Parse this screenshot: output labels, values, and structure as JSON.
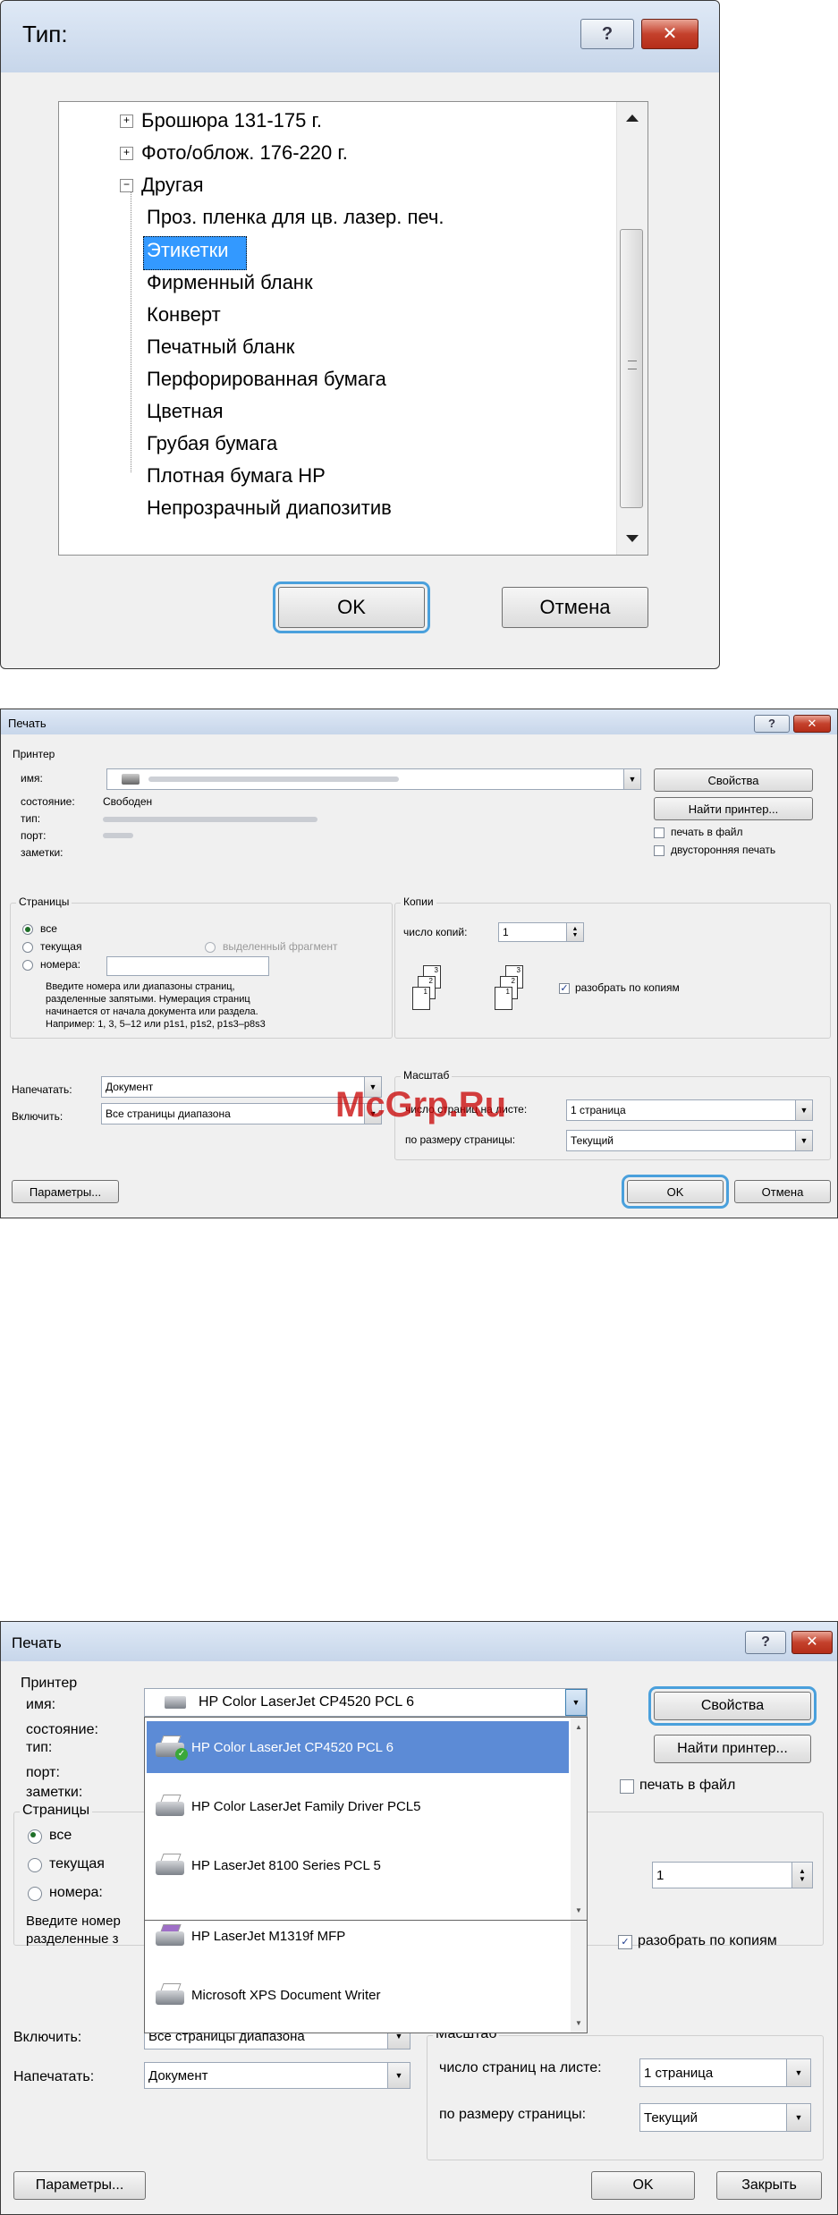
{
  "dialog1": {
    "title": "Тип:",
    "help_label": "?",
    "close_label": "✕",
    "tree": [
      {
        "label": "Брошюра 131-175 г.",
        "expander": "+",
        "level": 1
      },
      {
        "label": "Фото/облож. 176-220 г.",
        "expander": "+",
        "level": 1
      },
      {
        "label": "Другая",
        "expander": "−",
        "level": 1
      },
      {
        "label": "Проз. пленка для цв. лазер. печ.",
        "level": 2
      },
      {
        "label": "Этикетки",
        "level": 2,
        "selected": true
      },
      {
        "label": "Фирменный бланк",
        "level": 2
      },
      {
        "label": "Конверт",
        "level": 2
      },
      {
        "label": "Печатный бланк",
        "level": 2
      },
      {
        "label": "Перфорированная бумага",
        "level": 2
      },
      {
        "label": "Цветная",
        "level": 2
      },
      {
        "label": "Грубая бумага",
        "level": 2
      },
      {
        "label": "Плотная бумага HP",
        "level": 2
      },
      {
        "label": "Непрозрачный диапозитив",
        "level": 2
      }
    ],
    "ok_label": "OK",
    "cancel_label": "Отмена"
  },
  "dialog2": {
    "title": "Печать",
    "help_label": "?",
    "close_label": "✕",
    "printer_group": "Принтер",
    "name_label": "имя:",
    "status_label": "состояние:",
    "status_value": "Свободен",
    "type_label": "тип:",
    "port_label": "порт:",
    "notes_label": "заметки:",
    "properties_label": "Свойства",
    "find_printer_label": "Найти принтер...",
    "print_to_file_label": "печать в файл",
    "duplex_label": "двусторонняя печать",
    "pages_group": "Страницы",
    "all_label": "все",
    "current_label": "текущая",
    "selection_label": "выделенный фрагмент",
    "pages_label": "номера:",
    "pages_hint": [
      "Введите номера или диапазоны страниц,",
      "разделенные запятыми. Нумерация страниц",
      "начинается от начала документа или раздела.",
      "Например: 1, 3, 5–12 или p1s1, p1s2, p1s3–p8s3"
    ],
    "copies_group": "Копии",
    "copies_label": "число копий:",
    "copies_value": "1",
    "collate_label": "разобрать по копиям",
    "print_what_label": "Напечатать:",
    "print_what_value": "Документ",
    "include_label": "Включить:",
    "include_value": "Все страницы диапазона",
    "zoom_group": "Масштаб",
    "pages_per_sheet_label": "число страниц на листе:",
    "pages_per_sheet_value": "1 страница",
    "scale_label": "по размеру страницы:",
    "scale_value": "Текущий",
    "watermark": "McGrp.Ru",
    "options_label": "Параметры...",
    "ok_label": "OK",
    "cancel_label": "Отмена",
    "collate_pages": [
      "3",
      "2",
      "1"
    ]
  },
  "dialog3": {
    "title": "Печать",
    "help_label": "?",
    "close_label": "✕",
    "printer_group": "Принтер",
    "name_label": "имя:",
    "selected_printer": "HP Color LaserJet CP4520 PCL 6",
    "status_label": "состояние:",
    "type_label": "тип:",
    "port_label": "порт:",
    "notes_label": "заметки:",
    "properties_label": "Свойства",
    "find_printer_label": "Найти принтер...",
    "print_to_file_label": "печать в файл",
    "printer_list": [
      {
        "label": "HP Color LaserJet CP4520 PCL 6",
        "selected": true
      },
      {
        "label": "HP Color LaserJet Family Driver PCL5"
      },
      {
        "label": "HP LaserJet 8100 Series PCL 5"
      },
      {
        "label": "HP LaserJet M1319f MFP"
      },
      {
        "label": "Microsoft XPS Document Writer"
      }
    ],
    "pages_group": "Страницы",
    "all_label": "все",
    "current_label": "текущая",
    "pages_label": "номера:",
    "hint_line1": "Введите номер",
    "hint_line2": "разделенные з",
    "copies_value": "1",
    "collate_label": "разобрать по копиям",
    "include_label": "Включить:",
    "include_value": "Все страницы диапазона",
    "print_what_label": "Напечатать:",
    "print_what_value": "Документ",
    "zoom_group": "Масштаб",
    "pages_per_sheet_label": "число страниц на листе:",
    "pages_per_sheet_value": "1 страница",
    "scale_label": "по размеру страницы:",
    "scale_value": "Текущий",
    "options_label": "Параметры...",
    "ok_label": "OK",
    "close_button_label": "Закрыть"
  }
}
